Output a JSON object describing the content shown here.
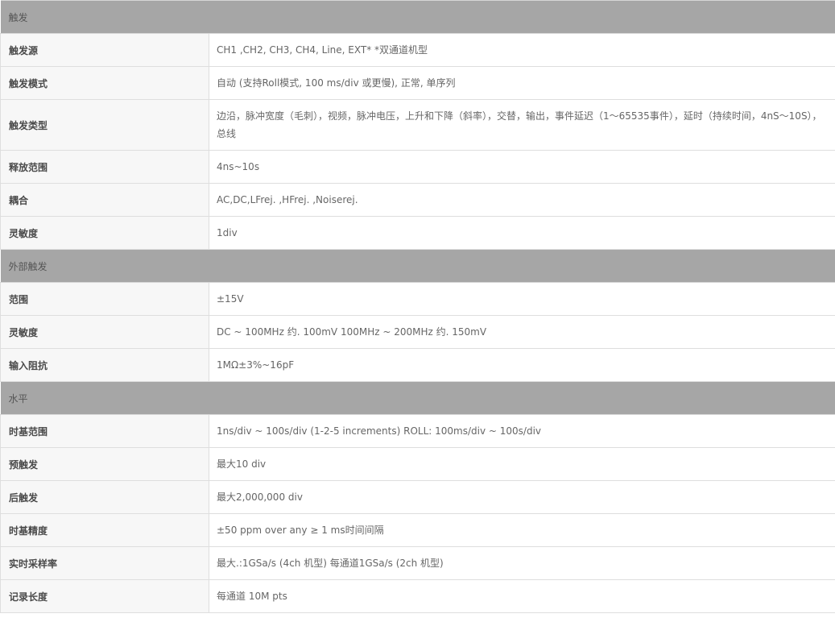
{
  "sections": [
    {
      "title": "触发",
      "rows": [
        {
          "label": "触发源",
          "value": "CH1 ,CH2, CH3, CH4, Line, EXT*  *双通道机型"
        },
        {
          "label": "触发模式",
          "value": "自动 (支持Roll模式, 100 ms/div 或更慢), 正常, 单序列"
        },
        {
          "label": "触发类型",
          "value": "边沿，脉冲宽度（毛刺），视频，脉冲电压，上升和下降（斜率），交替，输出，事件延迟（1～65535事件），延时（持续时间，4nS～10S），总线"
        },
        {
          "label": "释放范围",
          "value": "4ns~10s"
        },
        {
          "label": "耦合",
          "value": "AC,DC,LFrej. ,HFrej. ,Noiserej."
        },
        {
          "label": "灵敏度",
          "value": "1div"
        }
      ]
    },
    {
      "title": "外部触发",
      "rows": [
        {
          "label": "范围",
          "value": "±15V"
        },
        {
          "label": "灵敏度",
          "value": "DC ~ 100MHz 约. 100mV    100MHz ~ 200MHz 约. 150mV"
        },
        {
          "label": "输入阻抗",
          "value": "1MΩ±3%~16pF"
        }
      ]
    },
    {
      "title": "水平",
      "rows": [
        {
          "label": "时基范围",
          "value": "1ns/div ~ 100s/div (1-2-5 increments)    ROLL: 100ms/div ~ 100s/div"
        },
        {
          "label": "预触发",
          "value": "最大10 div"
        },
        {
          "label": "后触发",
          "value": "最大2,000,000 div"
        },
        {
          "label": "时基精度",
          "value": "±50 ppm over any ≥ 1 ms时间间隔"
        },
        {
          "label": "实时采样率",
          "value": "最大.:1GSa/s (4ch 机型)     每通道1GSa/s (2ch 机型)"
        },
        {
          "label": "记录长度",
          "value": "每通道 10M pts"
        }
      ]
    }
  ]
}
